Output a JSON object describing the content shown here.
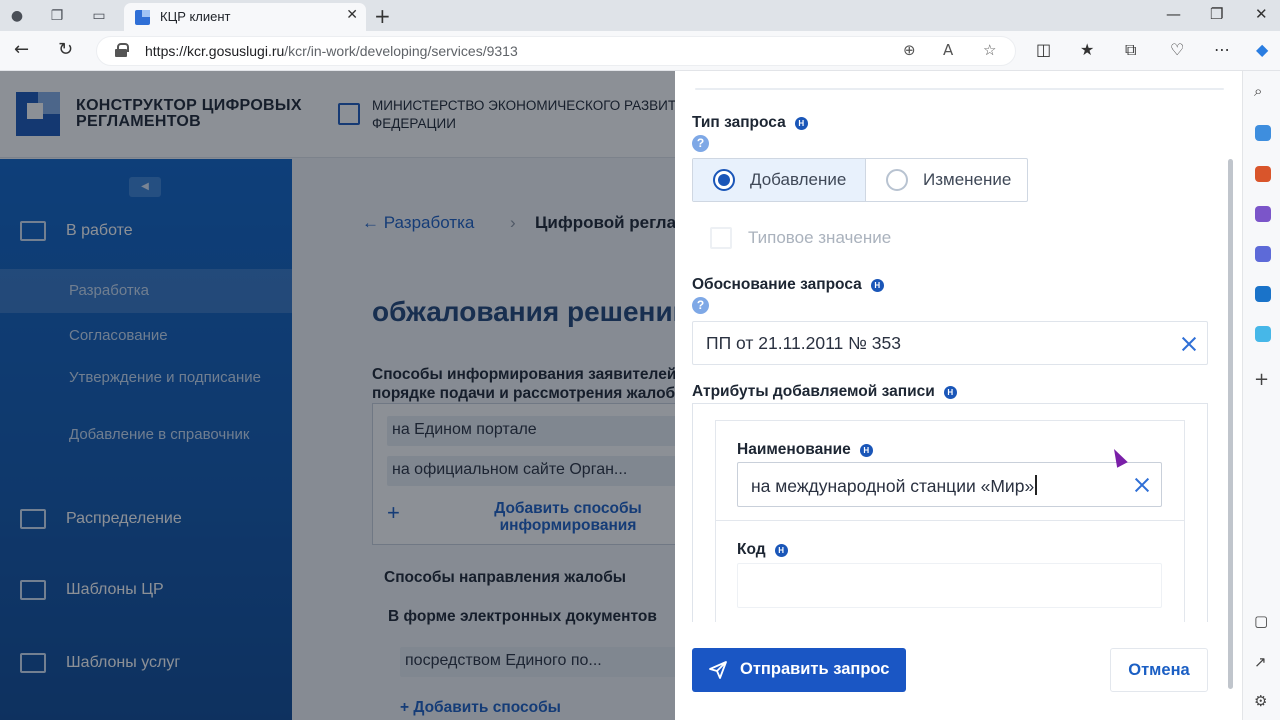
{
  "browser": {
    "tab_title": "КЦР клиент",
    "url_host": "https://kcr.gosuslugi.ru",
    "url_path": "/kcr/in-work/developing/services/9313"
  },
  "app": {
    "logo_text": "КОНСТРУКТОР ЦИФРОВЫХ РЕГЛАМЕНТОВ",
    "ministry_text": "МИНИСТЕРСТВО ЭКОНОМИЧЕСКОГО РАЗВИТ ФЕДЕРАЦИИ"
  },
  "leftnav": {
    "groups": [
      {
        "label": "В работе",
        "icon": "inbox-icon"
      },
      {
        "label": "Распределение",
        "icon": "list-icon"
      },
      {
        "label": "Шаблоны ЦР",
        "icon": "template-icon"
      },
      {
        "label": "Шаблоны услуг",
        "icon": "services-icon"
      }
    ],
    "sub_items": [
      "Разработка",
      "Согласование",
      "Утверждение и подписание",
      "Добавление в справочник"
    ]
  },
  "content": {
    "breadcrumb_back": "Разработка",
    "breadcrumb_current": "Цифровой регла",
    "title_partial": "обжалования решений",
    "section1_label": "Способы информирования заявителей о порядке подачи и рассмотрения жалоб",
    "chips1": [
      "на Едином портале",
      "на официальном сайте Орган..."
    ],
    "add_info_link": "Добавить способы информирования",
    "section2_label": "Способы направления жалобы",
    "section3_label": "В форме электронных документов",
    "chips2": [
      "посредством Единого по..."
    ],
    "add_methods_link": "Добавить способы"
  },
  "panel": {
    "request_type_label": "Тип запроса",
    "option_add": "Добавление",
    "option_change": "Изменение",
    "selected_option": "Добавление",
    "typical_value_label": "Типовое значение",
    "justification_label": "Обоснование запроса",
    "justification_value": "ПП от 21.11.2011 № 353",
    "attributes_label": "Атрибуты добавляемой записи",
    "name_label": "Наименование",
    "name_value": "на международной станции «Мир»",
    "code_label": "Код",
    "code_value": "",
    "send_button": "Отправить запрос",
    "cancel_button": "Отмена",
    "badge_letter": "Н",
    "help_mark": "?"
  },
  "colors": {
    "accent": "#1a56c4",
    "nav_bg": "#0f64c8",
    "link": "#1b5fc4"
  }
}
